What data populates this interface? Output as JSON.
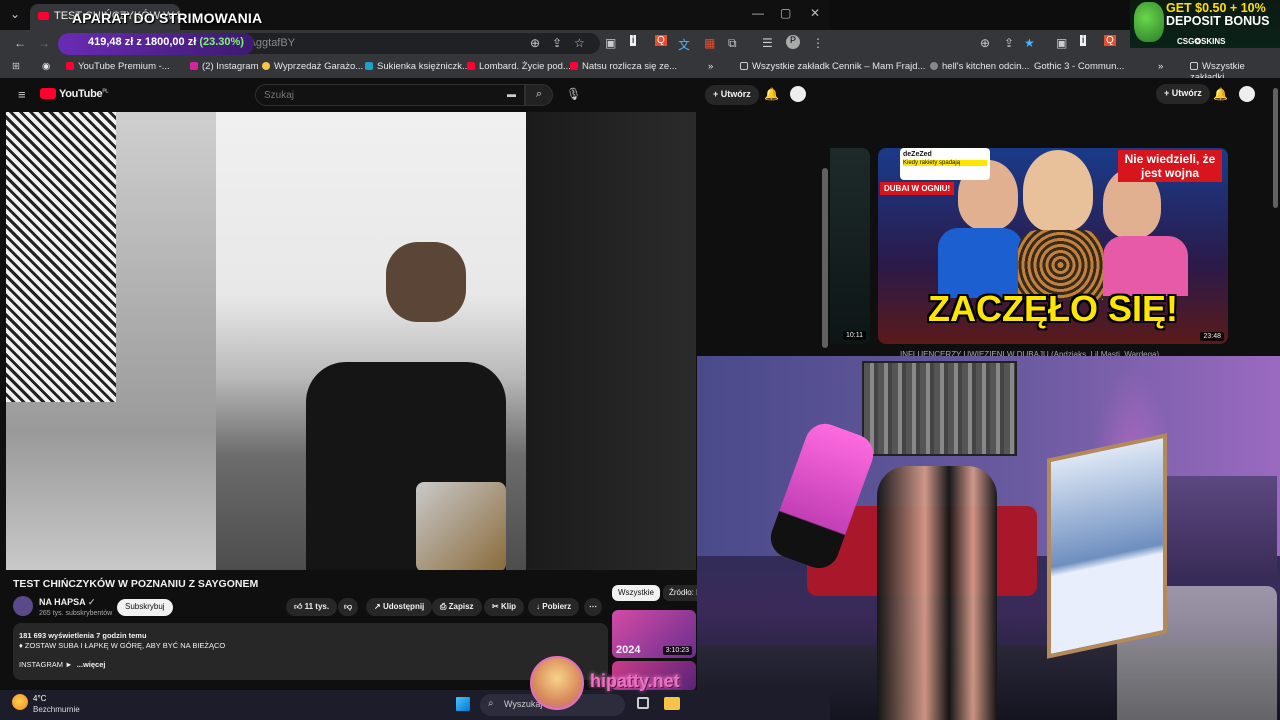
{
  "overlay": {
    "title": "APARAT DO STRIMOWANIA",
    "money": "419,48 zł z 1800,00 zł",
    "percent": "(23.30%)"
  },
  "tab": {
    "title": "TEST CHIŃCZYKÓW W PO"
  },
  "address": {
    "url_fragment": "jbAggtafBY"
  },
  "bookmarks_left": [
    "YouTube Premium -...",
    "(2) Instagram",
    "Wyprzedaż Garażo...",
    "Sukienka księżniczk...",
    "Lombard. Życie pod...",
    "Natsu rozlicza się ze..."
  ],
  "bookmarks_all": "Wszystkie zakładki",
  "bookmarks_right": [
    "Cennik – Mam Frajd...",
    "hell's kitchen odcin...",
    "Gothic 3 - Commun..."
  ],
  "youtube": {
    "logo": "YouTube",
    "region": "PL",
    "search_placeholder": "Szukaj",
    "create": "Utwórz",
    "video_title": "TEST CHIŃCZYKÓW W POZNANIU Z SAYGONEM",
    "channel": "NA HAPSA",
    "subscribers": "265 tys. subskrybentów",
    "subscribe": "Subskrybuj",
    "likes": "11 tys.",
    "share": "Udostępnij",
    "save": "Zapisz",
    "clip": "Klip",
    "download": "Pobierz",
    "stats": "181 693 wyświetlenia  7 godzin temu",
    "desc_line": "♦ ZOSTAW SUBA I ŁAPKĘ W GÓRĘ, ABY BYĆ NA BIEŻĄCO",
    "desc_insta": "INSTAGRAM ►",
    "more": "...więcej",
    "chips": [
      "Wszystkie",
      "Źródło: NA"
    ],
    "thumb1_year": "2024",
    "thumb1_dur": "3:10:23"
  },
  "right": {
    "create": "Utwórz",
    "thumb_headline": "ZACZĘŁO SIĘ!",
    "thumb_nie": "Nie wiedzieli, że jest wojna",
    "thumb_dubai": "DUBAI W OGNIU!",
    "thumb_card": "deZeZed",
    "thumb_card2": "Kiedy rakiety spadają",
    "thumb_dur": "23:48",
    "side_dur": "10:11",
    "video_title": "INFLUENCERZY UWIĘZIENI W DUBAJU (Andziaks, Lil Masti, Wardega)"
  },
  "ad": {
    "line1": "GET $0.50 + 10%",
    "line2": "DEPOSIT BONUS",
    "brand": "CSG✪SKINS"
  },
  "taskbar": {
    "temp": "4°C",
    "condition": "Bezchmurnie",
    "search": "Wyszukaj"
  },
  "watermark": "hipatty.net"
}
